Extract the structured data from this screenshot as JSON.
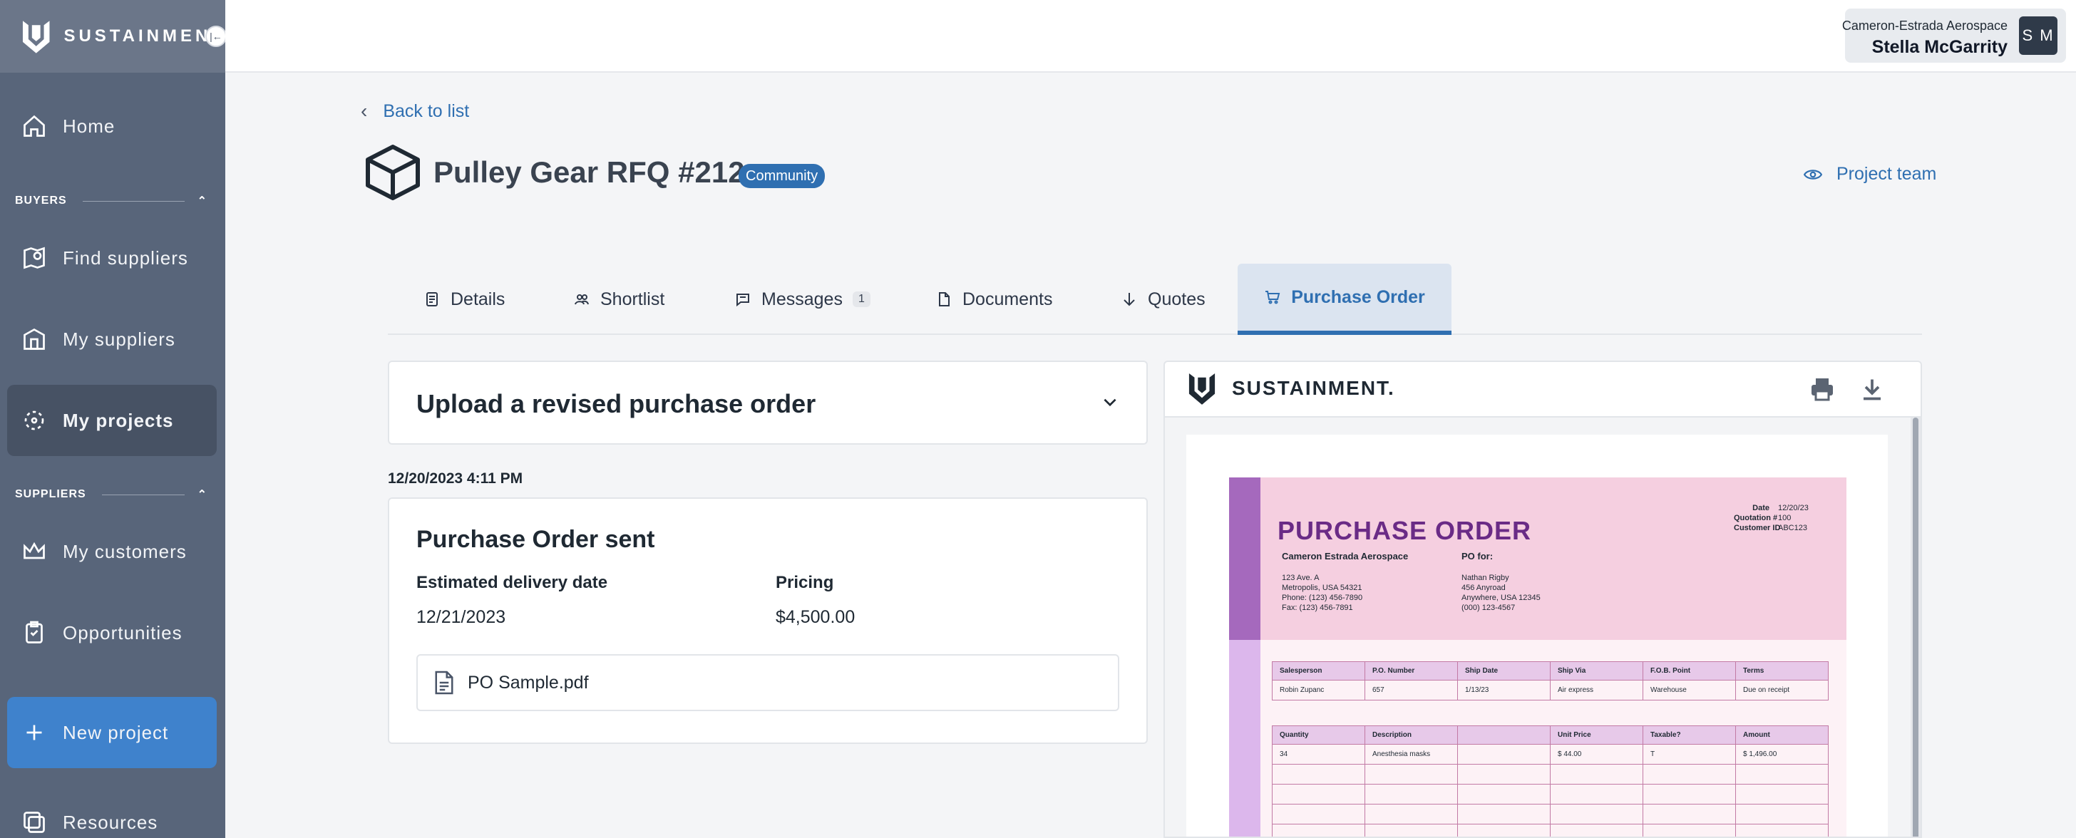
{
  "sidebar": {
    "brand": "SUSTAINMENT",
    "items": [
      {
        "label": "Home"
      },
      {
        "label": "Find suppliers"
      },
      {
        "label": "My suppliers"
      },
      {
        "label": "My projects"
      },
      {
        "label": "My customers"
      },
      {
        "label": "Opportunities"
      },
      {
        "label": "New project"
      },
      {
        "label": "Resources"
      }
    ],
    "sections": {
      "buyers": "BUYERS",
      "suppliers": "SUPPLIERS"
    }
  },
  "user": {
    "org": "Cameron-Estrada Aerospace",
    "name": "Stella McGarrity",
    "initials": "S M"
  },
  "header": {
    "back": "Back to list",
    "title": "Pulley Gear RFQ #212",
    "badge": "Community",
    "team": "Project team"
  },
  "tabs": [
    {
      "label": "Details"
    },
    {
      "label": "Shortlist"
    },
    {
      "label": "Messages",
      "count": "1"
    },
    {
      "label": "Documents"
    },
    {
      "label": "Quotes"
    },
    {
      "label": "Purchase Order"
    }
  ],
  "upload": {
    "title": "Upload a revised purchase order"
  },
  "po_event": {
    "timestamp": "12/20/2023 4:11 PM",
    "title": "Purchase Order sent",
    "delivery_label": "Estimated delivery date",
    "delivery_value": "12/21/2023",
    "pricing_label": "Pricing",
    "pricing_value": "$4,500.00",
    "file_name": "PO Sample.pdf"
  },
  "preview": {
    "brand": "SUSTAINMENT.",
    "doc": {
      "heading": "PURCHASE ORDER",
      "meta_labels": [
        "Date",
        "Quotation #",
        "Customer ID"
      ],
      "meta_values": [
        "12/20/23",
        "100",
        "ABC123"
      ],
      "from_name": "Cameron Estrada Aerospace",
      "from_lines": [
        "123 Ave. A",
        "Metropolis, USA 54321",
        "Phone: (123) 456-7890",
        "Fax: (123) 456-7891"
      ],
      "for_label": "PO for:",
      "for_lines": [
        "Nathan Rigby",
        "",
        "456 Anyroad",
        "Anywhere, USA 12345",
        "(000) 123-4567"
      ],
      "t1_head": [
        "Salesperson",
        "P.O. Number",
        "Ship Date",
        "Ship Via",
        "F.O.B. Point",
        "Terms"
      ],
      "t1_row": [
        "Robin Zupanc",
        "657",
        "1/13/23",
        "Air express",
        "Warehouse",
        "Due on receipt"
      ],
      "t2_head": [
        "Quantity",
        "Description",
        "",
        "Unit Price",
        "Taxable?",
        "Amount"
      ],
      "t2_row": [
        "34",
        "Anesthesia masks",
        "",
        "$          44.00",
        "T",
        "$        1,496.00"
      ]
    }
  }
}
